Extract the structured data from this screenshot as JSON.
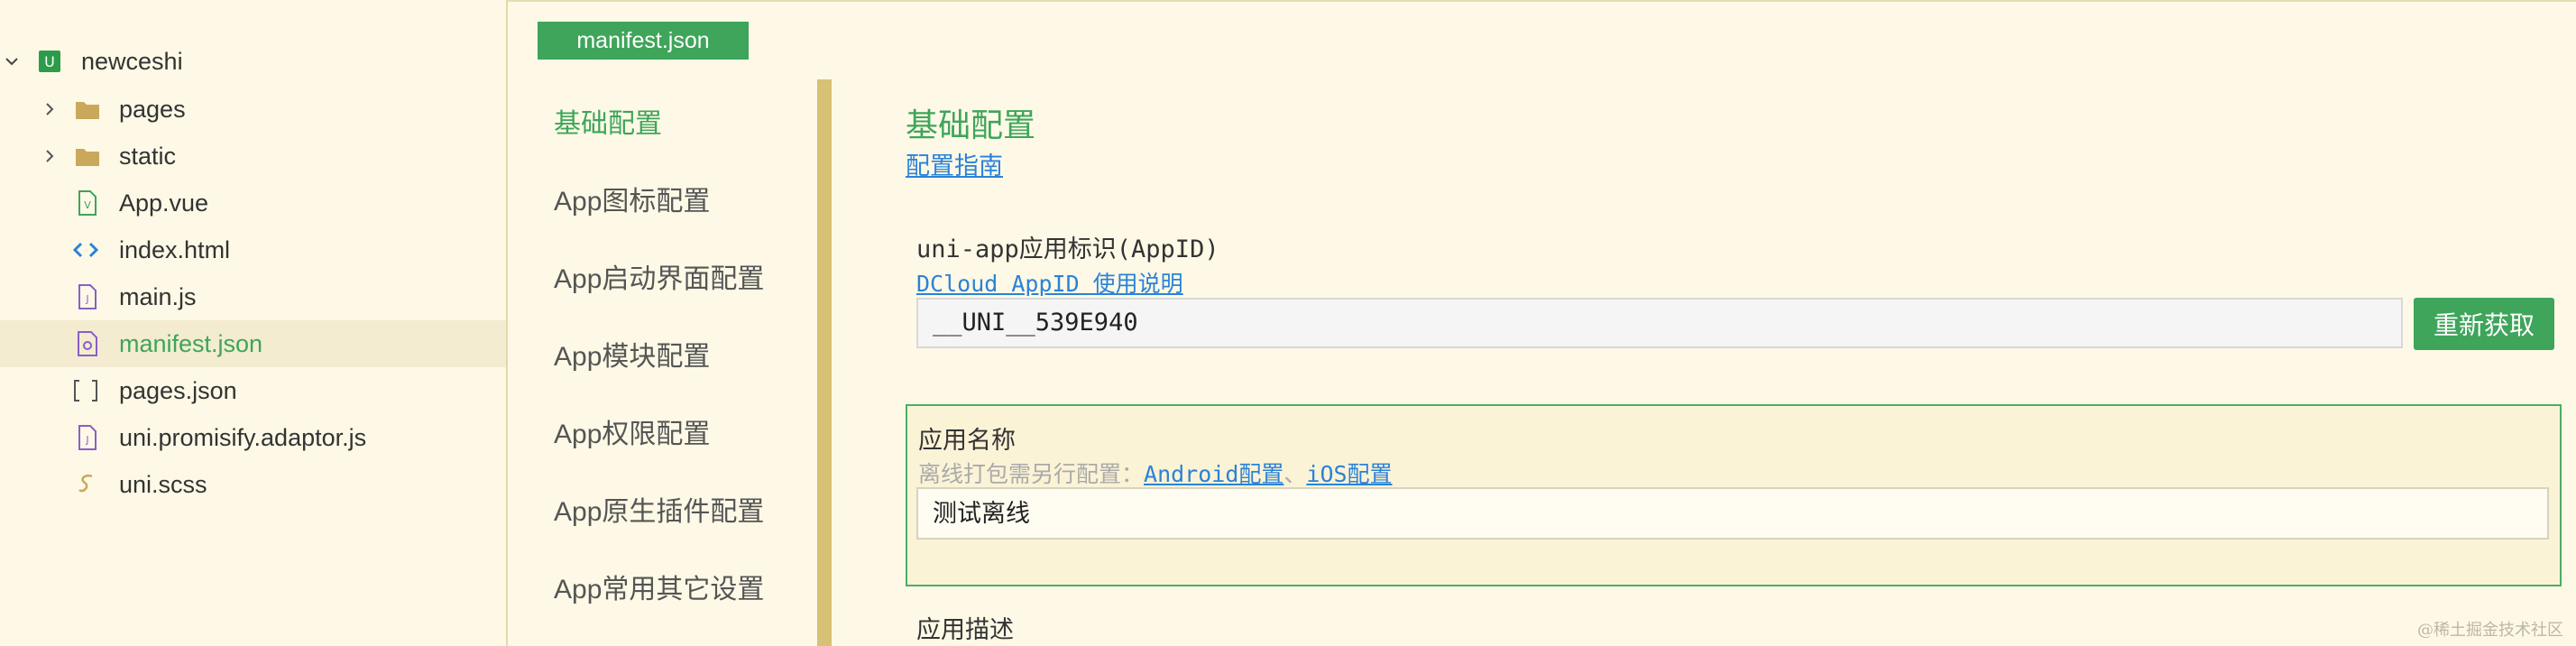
{
  "filetree": {
    "root": {
      "label": "newceshi",
      "icon": "uni-project-icon",
      "expanded": true
    },
    "items": [
      {
        "label": "pages",
        "type": "folder",
        "icon": "folder-icon",
        "expandable": true
      },
      {
        "label": "static",
        "type": "folder",
        "icon": "folder-icon",
        "expandable": true
      },
      {
        "label": "App.vue",
        "type": "vue",
        "icon": "vue-file-icon"
      },
      {
        "label": "index.html",
        "type": "html",
        "icon": "html-file-icon"
      },
      {
        "label": "main.js",
        "type": "js",
        "icon": "js-file-icon"
      },
      {
        "label": "manifest.json",
        "type": "manifest",
        "icon": "manifest-file-icon",
        "active": true
      },
      {
        "label": "pages.json",
        "type": "json",
        "icon": "json-file-icon"
      },
      {
        "label": "uni.promisify.adaptor.js",
        "type": "js",
        "icon": "js-file-icon"
      },
      {
        "label": "uni.scss",
        "type": "scss",
        "icon": "scss-file-icon"
      }
    ]
  },
  "editor": {
    "tab_label": "manifest.json"
  },
  "settings_nav": {
    "items": [
      {
        "label": "基础配置",
        "active": true
      },
      {
        "label": "App图标配置"
      },
      {
        "label": "App启动界面配置"
      },
      {
        "label": "App模块配置"
      },
      {
        "label": "App权限配置"
      },
      {
        "label": "App原生插件配置"
      },
      {
        "label": "App常用其它设置"
      }
    ]
  },
  "content": {
    "title": "基础配置",
    "guide_link": "配置指南",
    "appid": {
      "label": "uni-app应用标识(AppID)",
      "help_link": "DCloud AppID 使用说明",
      "value": "__UNI__539E940",
      "refresh_button": "重新获取"
    },
    "app_name": {
      "label": "应用名称",
      "hint_prefix": "离线打包需另行配置：",
      "android_link": "Android配置",
      "separator": "、",
      "ios_link": "iOS配置",
      "value": "测试离线"
    },
    "app_desc": {
      "label": "应用描述"
    }
  },
  "watermark": "@稀土掘金技术社区",
  "colors": {
    "background": "#fdf9e6",
    "accent_green": "#3ea55a",
    "link_blue": "#2b82d9",
    "scroll_bar": "#d7c175"
  }
}
